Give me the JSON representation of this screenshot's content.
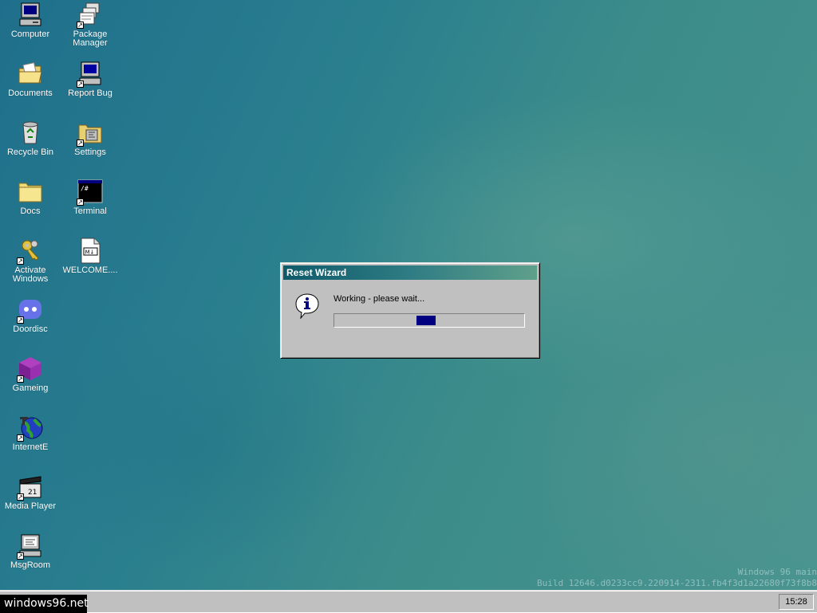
{
  "desktop": {
    "icons": [
      {
        "label": "Computer",
        "icon": "computer-icon"
      },
      {
        "label": "Package Manager",
        "icon": "package-manager-icon"
      },
      {
        "label": "Documents",
        "icon": "folder-documents-icon"
      },
      {
        "label": "Report Bug",
        "icon": "report-bug-computer-icon"
      },
      {
        "label": "Recycle Bin",
        "icon": "recycle-bin-icon"
      },
      {
        "label": "Settings",
        "icon": "settings-folder-icon"
      },
      {
        "label": "Docs",
        "icon": "folder-icon"
      },
      {
        "label": "Terminal",
        "icon": "terminal-icon"
      },
      {
        "label": "Activate Windows",
        "icon": "keys-icon"
      },
      {
        "label": "WELCOME....",
        "icon": "markdown-file-icon"
      },
      {
        "label": "Doordisc",
        "icon": "doordisc-icon"
      },
      {
        "label": "Gameing",
        "icon": "gameing-cube-icon"
      },
      {
        "label": "InternetE",
        "icon": "globe-icon"
      },
      {
        "label": "Media Player",
        "icon": "clapperboard-icon"
      },
      {
        "label": "MsgRoom",
        "icon": "msgroom-icon"
      }
    ]
  },
  "dialog": {
    "title": "Reset Wizard",
    "message": "Working - please wait...",
    "icon": "info-icon",
    "progress_indeterminate": true
  },
  "watermark": {
    "line1": "Windows 96 main",
    "line2": "Build 12646.d0233cc9.220914-2311.fb4f3d1a22680f73f8b8"
  },
  "taskbar": {
    "start_label": "windows96.net",
    "clock": "15:28"
  },
  "colors": {
    "titlebar_start": "#0e5a6a",
    "titlebar_end": "#5fa08a",
    "progress_chunk": "#000080",
    "desktop_base": "#2a7f8e"
  }
}
